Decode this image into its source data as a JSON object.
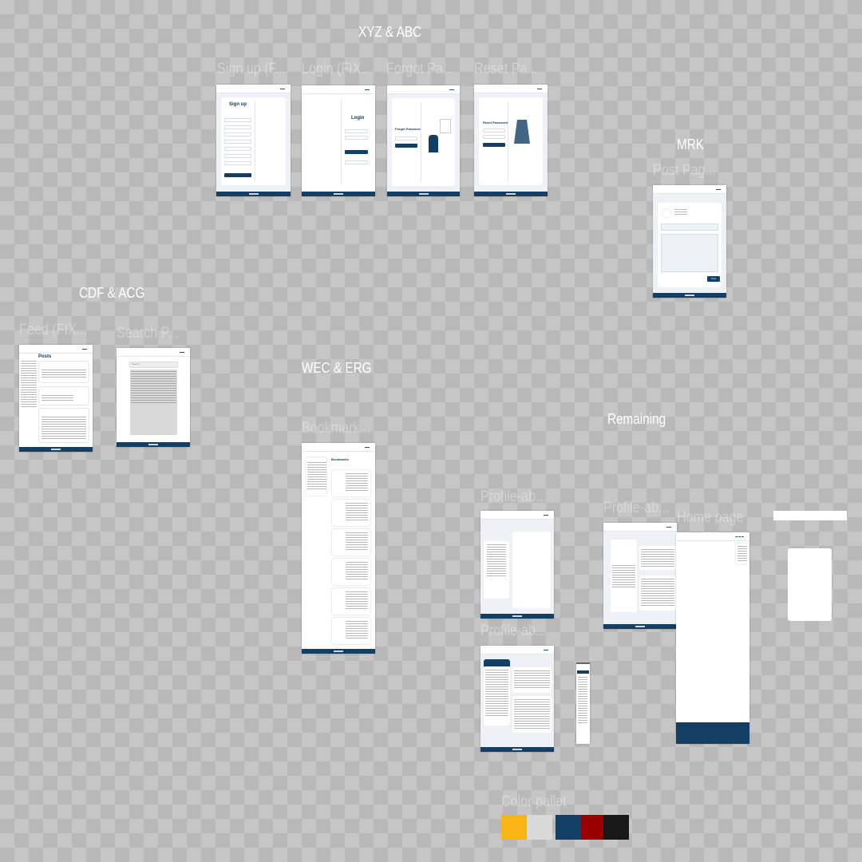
{
  "sections": {
    "xyz": "XYZ & ABC",
    "mrk": "MRK",
    "cdf": "CDF & ACG",
    "wec": "WEC & ERG",
    "remaining": "Remaining"
  },
  "frames": {
    "signup": {
      "label": "Sign up (F...",
      "title": "Sign up"
    },
    "login": {
      "label": "Login (FIX...",
      "title": "Login"
    },
    "forgot": {
      "label": "Forgot Pa...",
      "title": "Forgot Password"
    },
    "reset": {
      "label": "Reset Pa...",
      "title": "Reset Password"
    },
    "post": {
      "label": "Post Pag...",
      "button": "Post"
    },
    "feed": {
      "label": "Feed (FIX...",
      "title": "Posts"
    },
    "search": {
      "label": "Search P...",
      "placeholder": "Search"
    },
    "bookmark": {
      "label": "Bookmark...",
      "title": "Bookmarks"
    },
    "profile1": {
      "label": "Profile-ab..."
    },
    "profile2": {
      "label": "Profile-ab..."
    },
    "profile3": {
      "label": "Profile-ab..."
    },
    "home": {
      "label": "Home page"
    }
  },
  "palette": {
    "label": "Color pallet",
    "colors": [
      "#F9B515",
      "#D9D9D9",
      "#123F63",
      "#990000",
      "#181818"
    ]
  }
}
